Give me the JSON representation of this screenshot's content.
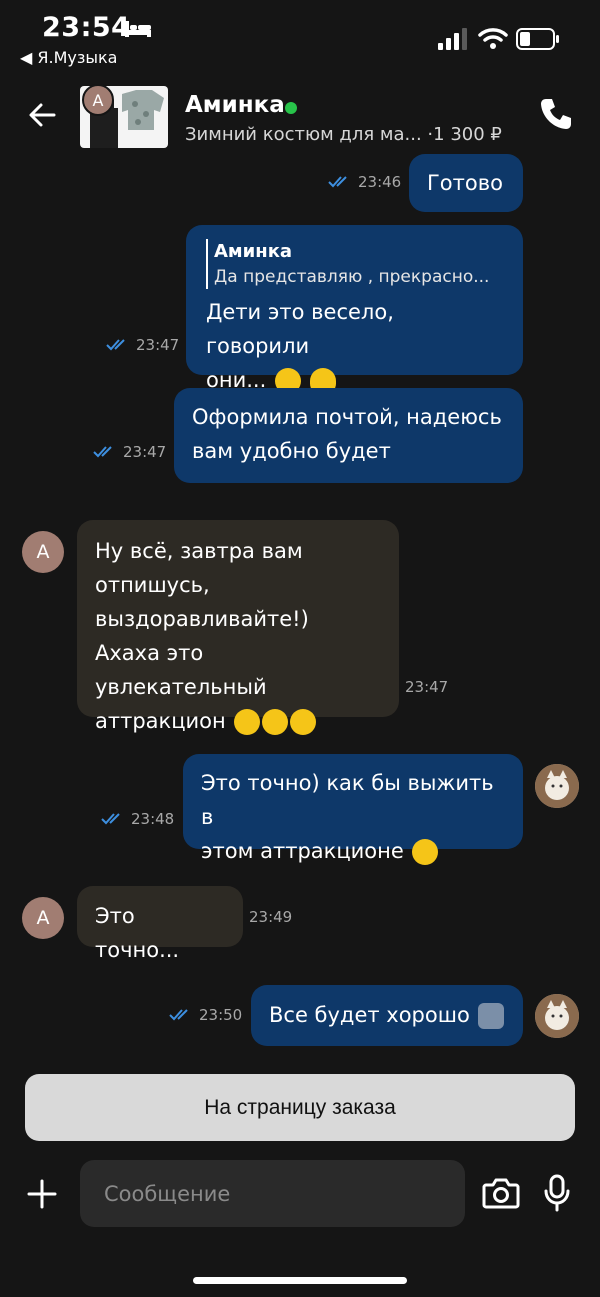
{
  "status_bar": {
    "time": "23:54",
    "back_app": "◀ Я.Музыка"
  },
  "header": {
    "avatar_letter": "А",
    "name": "Аминка",
    "online": true,
    "subtitle": "Зимний костюм для ма... ·1 300 ₽"
  },
  "messages": [
    {
      "dir": "out",
      "text": "Готово",
      "time": "23:46",
      "read": true
    },
    {
      "dir": "out",
      "quote_name": "Аминка",
      "quote_text": "Да представляю , прекрасно...",
      "text_line1": "Дети это весело, говорили",
      "text_line2": "они...",
      "emojis": [
        "sweat-smile-emoji",
        "melting-face-emoji"
      ],
      "time": "23:47",
      "read": true
    },
    {
      "dir": "out",
      "text_line1": "Оформила почтой, надеюсь",
      "text_line2": "вам удобно будет",
      "time": "23:47",
      "read": true
    },
    {
      "dir": "in",
      "avatar_letter": "А",
      "lines": [
        "Ну всё, завтра вам",
        "отпишусь,",
        "выздоравливайте!)",
        "Ахаха это увлекательный",
        "аттракцион"
      ],
      "emojis": [
        "tears-of-joy-emoji",
        "tears-of-joy-emoji",
        "tears-of-joy-emoji"
      ],
      "time": "23:47"
    },
    {
      "dir": "out",
      "text_line1": "Это точно) как бы выжить в",
      "text_line2": "этом аттракционе",
      "emojis": [
        "face-holding-back-tears-emoji"
      ],
      "time": "23:48",
      "read": true
    },
    {
      "dir": "in",
      "avatar_letter": "А",
      "text": "Это точно...",
      "time": "23:49"
    },
    {
      "dir": "out",
      "text": "Все будет хорошо",
      "emojis": [
        "people-hugging-emoji"
      ],
      "time": "23:50",
      "read": true
    }
  ],
  "order_button": "На страницу заказа",
  "composer": {
    "placeholder": "Сообщение"
  },
  "colors": {
    "background": "#151515",
    "outgoing_bubble": "#0e3869",
    "incoming_bubble": "#2d2a24",
    "online_dot": "#28c34a",
    "read_check": "#3d8fe0"
  }
}
